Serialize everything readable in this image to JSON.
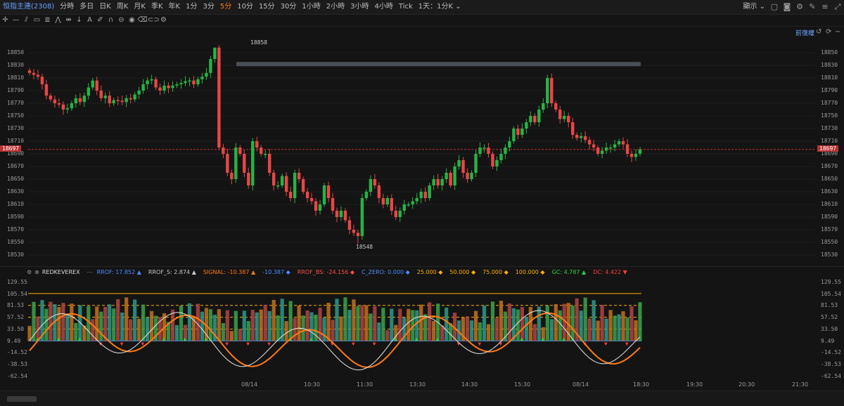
{
  "topbar": {
    "symbol": "恒指主連(2308)",
    "timeframes": [
      "分時",
      "多日",
      "日K",
      "周K",
      "月K",
      "季K",
      "年K",
      "1分",
      "3分",
      "5分",
      "10分",
      "15分",
      "30分",
      "1小時",
      "2小時",
      "3小時",
      "4小時",
      "Tick",
      "1天：1分K ⌄"
    ],
    "active_timeframe_index": 9,
    "right_label": "顯示 ⌄"
  },
  "link_label": "前復權",
  "price_axis": [
    "18850",
    "18830",
    "18810",
    "18790",
    "18770",
    "18750",
    "18730",
    "18710",
    "18690",
    "18670",
    "18650",
    "18630",
    "18610",
    "18590",
    "18570",
    "18550",
    "18530"
  ],
  "current_price": "18697",
  "high_label": "18858",
  "low_label": "18548",
  "indicator": {
    "name": "REDKEVEREX",
    "items": [
      {
        "label": "RROF:",
        "value": "17.852 ▲",
        "color": "#4d8bff"
      },
      {
        "label": "RROF_S:",
        "value": "2.874 ▲",
        "color": "#c8c8c8"
      },
      {
        "label": "SIGNAL:",
        "value": "-10.387 ▲",
        "color": "#ff7a1a"
      },
      {
        "label": "",
        "value": "-10.387 ◆",
        "color": "#4d8bff"
      },
      {
        "label": "RROF_BS:",
        "value": "-24.156 ◆",
        "color": "#ff4d4d"
      },
      {
        "label": "C_ZERO:",
        "value": "0.000 ◆",
        "color": "#4d8bff"
      },
      {
        "label": "",
        "value": "25.000 ◆",
        "color": "#ffb000"
      },
      {
        "label": "",
        "value": "50.000 ◆",
        "color": "#ffb000"
      },
      {
        "label": "",
        "value": "75.000 ◆",
        "color": "#ffb000"
      },
      {
        "label": "",
        "value": "100.000 ◆",
        "color": "#ffb000"
      },
      {
        "label": "GC:",
        "value": "4.787 ▲",
        "color": "#2fd14a"
      },
      {
        "label": "DC:",
        "value": "4.422 ▼",
        "color": "#ff3b3b"
      }
    ],
    "axis": [
      "129.55",
      "105.54",
      "81.53",
      "57.52",
      "33.50",
      "9.49",
      "-14.52",
      "-38.53",
      "-62.54"
    ]
  },
  "time_axis": [
    "08/14",
    "10:30",
    "11:30",
    "13:30",
    "14:30",
    "15:30",
    "08/14",
    "18:30",
    "19:30",
    "20:30",
    "21:30"
  ],
  "colors": {
    "up": "#27b345",
    "down": "#e84646",
    "accent": "#ff7a1a"
  }
}
